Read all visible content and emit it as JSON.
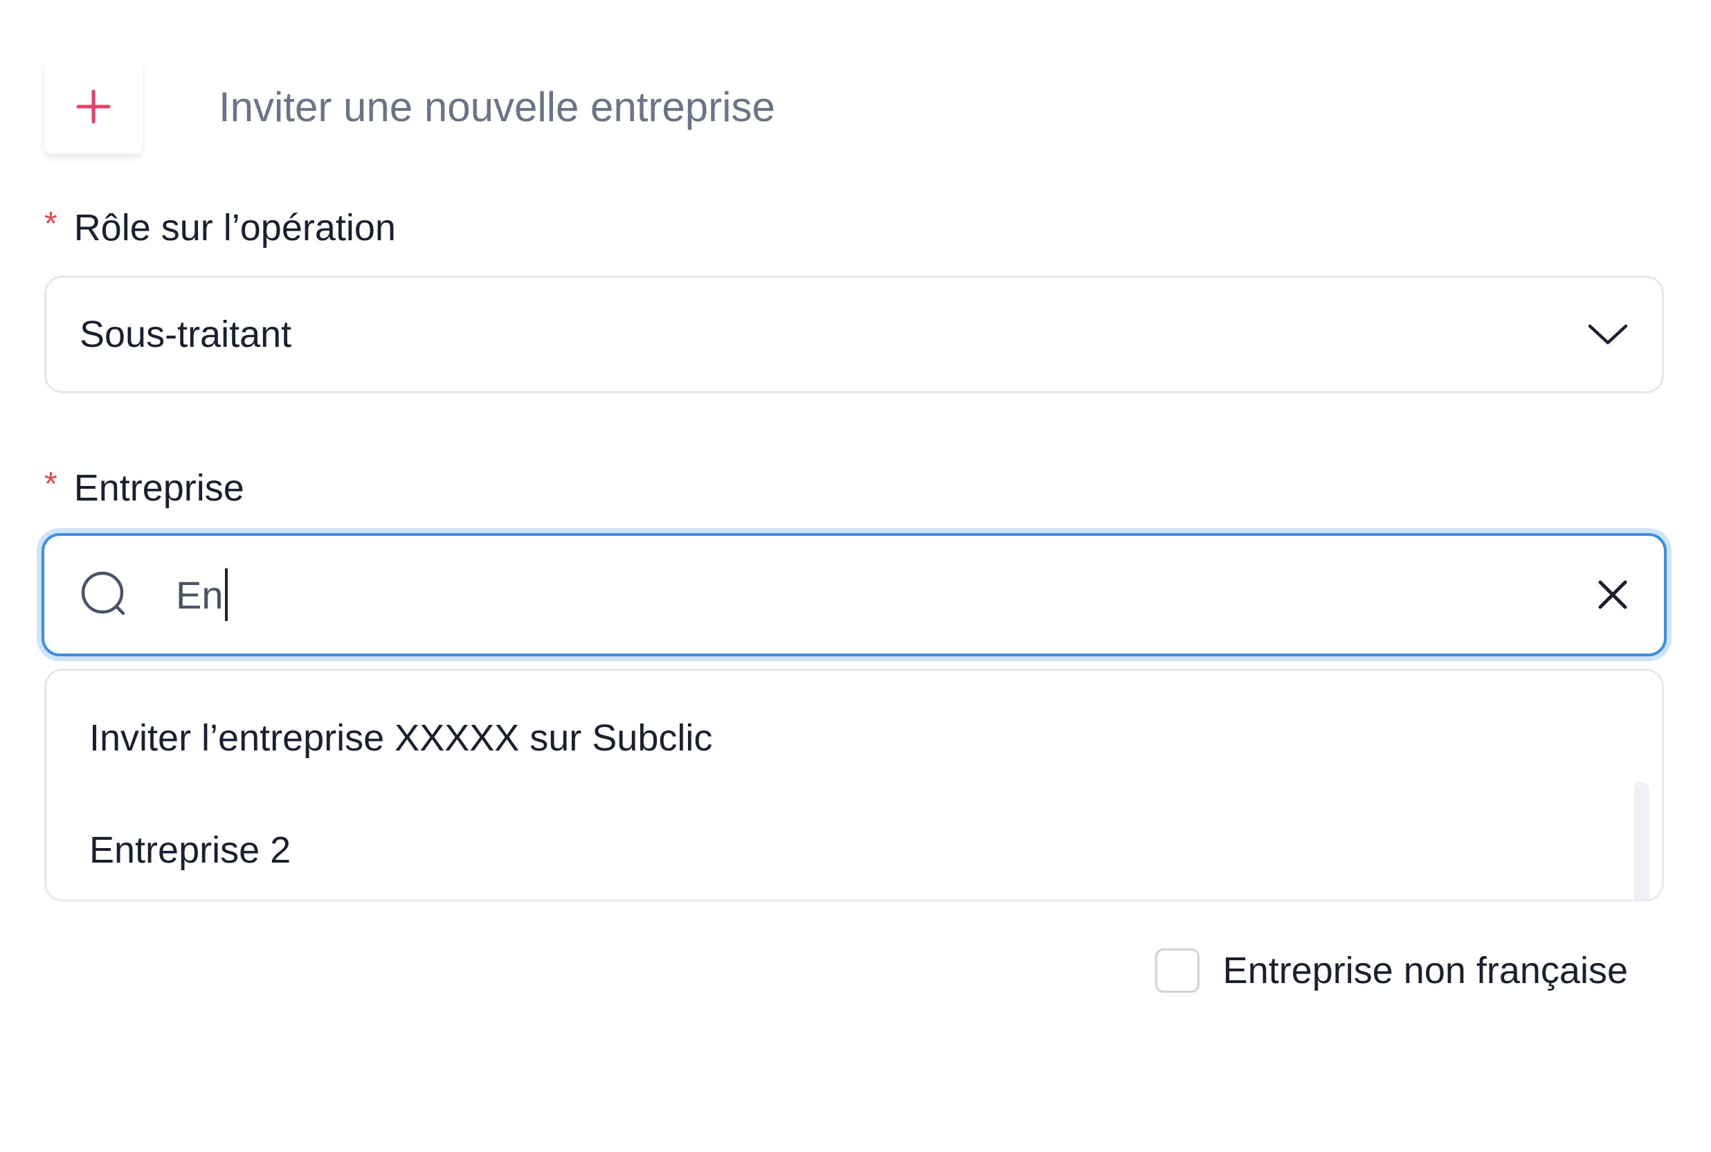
{
  "invite": {
    "label": "Inviter une nouvelle entreprise",
    "icon": "plus-icon",
    "icon_color": "#e8406a"
  },
  "role_field": {
    "required_marker": "*",
    "label": "Rôle sur l’opération",
    "value": "Sous-traitant",
    "icon": "chevron-down-icon"
  },
  "company_field": {
    "required_marker": "*",
    "label": "Entreprise",
    "search_value": "En",
    "search_icon": "search-icon",
    "clear_icon": "close-icon",
    "focus_color": "#3b8ee8"
  },
  "dropdown": {
    "options": [
      {
        "label": "Inviter l’entreprise XXXXX sur Subclic"
      },
      {
        "label": "Entreprise 2"
      }
    ]
  },
  "foreign_company": {
    "label": "Entreprise non française",
    "checked": false
  },
  "colors": {
    "required": "#e5484d",
    "text": "#1b2030",
    "muted": "#6b7386",
    "border": "#e4e7ec"
  }
}
